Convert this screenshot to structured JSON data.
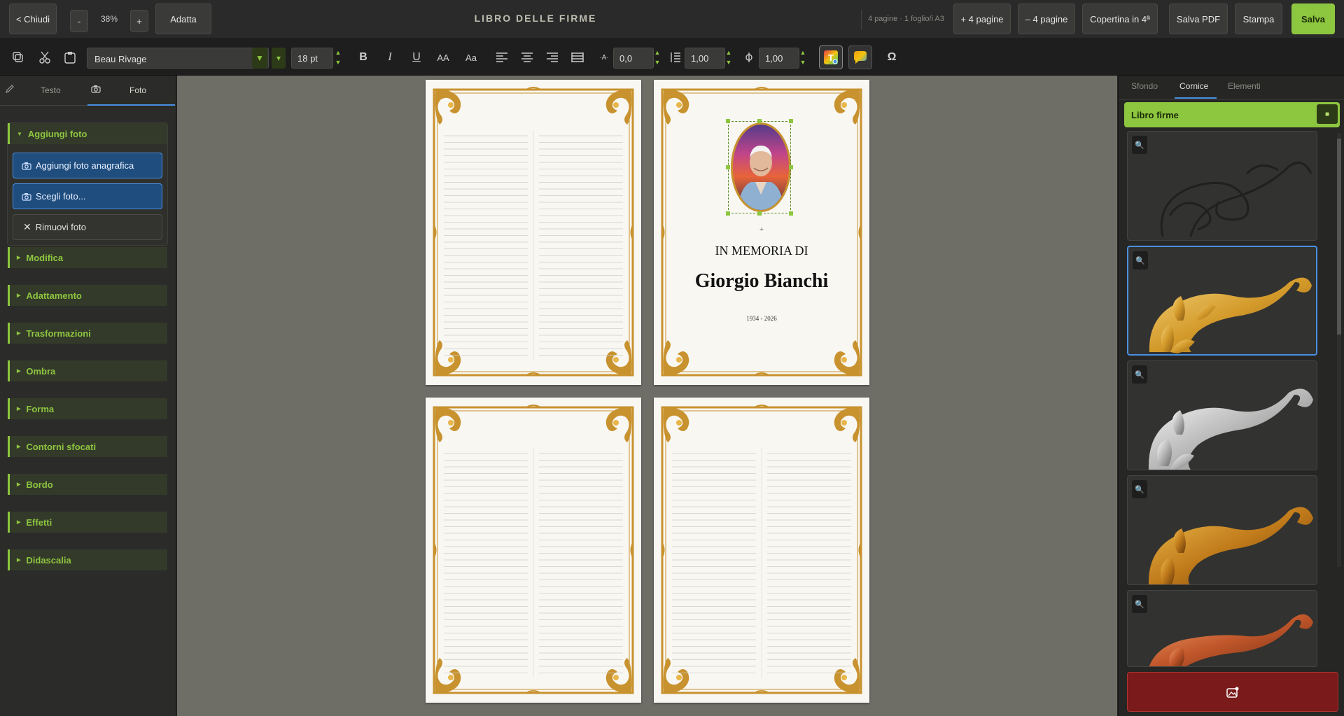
{
  "topbar": {
    "close_label": "< Chiudi",
    "zoom_minus": "-",
    "zoom_value": "38%",
    "zoom_plus": "+",
    "fit_label": "Adatta",
    "title": "LIBRO DELLE FIRME",
    "page_info": "4 pagine · 1 foglio/i A3",
    "add_pages": "+ 4 pagine",
    "remove_pages": "– 4 pagine",
    "cover_label": "Copertina in 4ª",
    "save_pdf": "Salva PDF",
    "print": "Stampa",
    "save": "Salva"
  },
  "toolbar": {
    "font_name": "Beau Rivage",
    "font_size": "18 pt",
    "bold": "B",
    "italic": "I",
    "underline": "U",
    "uppercase": "AA",
    "capitalize": "Aa",
    "letter_spacing_value": "0,0",
    "line_height_value": "1,00",
    "scale_value": "1,00",
    "special_char": "Ω"
  },
  "left_panel": {
    "tab_text": "Testo",
    "tab_photo": "Foto",
    "add_photo_group": "Aggiungi foto",
    "btn_add_profile_photo": "Aggiungi foto anagrafica",
    "btn_choose_photo": "Scegli foto...",
    "btn_remove_photo": "Rimuovi foto",
    "groups": [
      "Modifica",
      "Adattamento",
      "Trasformazioni",
      "Ombra",
      "Forma",
      "Contorni sfocati",
      "Bordo",
      "Effetti",
      "Didascalia"
    ]
  },
  "cover": {
    "in_memory": "IN MEMORIA DI",
    "name": "Giorgio Bianchi",
    "years": "1934 - 2026",
    "plus": "+"
  },
  "right_panel": {
    "tabs": [
      "Sfondo",
      "Cornice",
      "Elementi"
    ],
    "active_tab": "Cornice",
    "collection": "Libro firme",
    "collection_toggle": "■",
    "ornaments": [
      {
        "style": "outline-dark"
      },
      {
        "style": "gold",
        "selected": true
      },
      {
        "style": "silver"
      },
      {
        "style": "gold-dark"
      },
      {
        "style": "copper"
      }
    ]
  },
  "colors": {
    "accent_green": "#8dc63f",
    "accent_blue": "#4a90e2",
    "frame_gold": "#c8922e",
    "danger_red": "#7a1a1a"
  }
}
